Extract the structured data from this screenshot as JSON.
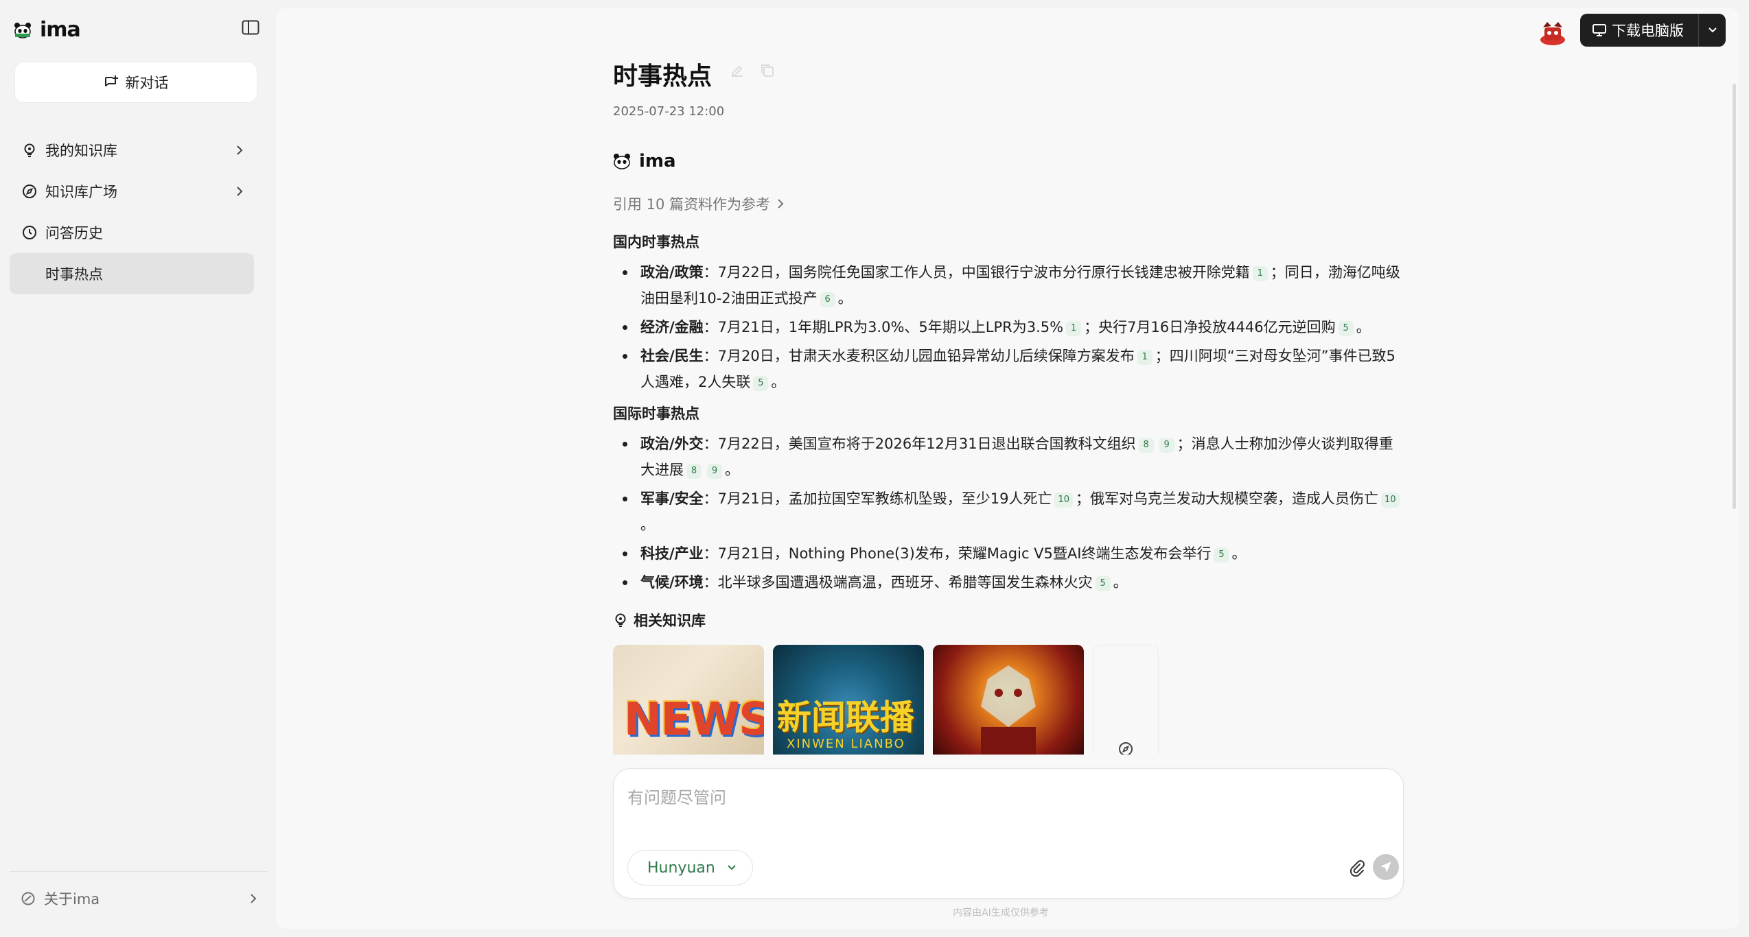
{
  "sidebar": {
    "logo_text": "ima",
    "new_chat_label": "新对话",
    "items": [
      {
        "label": "我的知识库",
        "icon": "bulb-icon"
      },
      {
        "label": "知识库广场",
        "icon": "compass-icon"
      },
      {
        "label": "问答历史",
        "icon": "clock-icon"
      }
    ],
    "history_item": "时事热点",
    "about_label": "关于ima"
  },
  "header": {
    "download_label": "下载电脑版"
  },
  "conversation": {
    "title": "时事热点",
    "timestamp": "2025-07-23 12:00",
    "bot_name": "ima",
    "refs_label": "引用 10 篇资料作为参考",
    "domestic": {
      "heading": "国内时事热点",
      "items": [
        {
          "tag": "政治/政策",
          "p1": "：7月22日，国务院任免国家工作人员，中国银行宁波市分行原行长钱建忠被开除党籍",
          "c1": "1",
          "p2": "；同日，渤海亿吨级油田垦利10-2油田正式投产",
          "c2": "6",
          "p3": "。"
        },
        {
          "tag": "经济/金融",
          "p1": "：7月21日，1年期LPR为3.0%、5年期以上LPR为3.5%",
          "c1": "1",
          "p2": "；央行7月16日净投放4446亿元逆回购",
          "c2": "5",
          "p3": "。"
        },
        {
          "tag": "社会/民生",
          "p1": "：7月20日，甘肃天水麦积区幼儿园血铅异常幼儿后续保障方案发布",
          "c1": "1",
          "p2": "；四川阿坝“三对母女坠河”事件已致5人遇难，2人失联",
          "c2": "5",
          "p3": "。"
        }
      ]
    },
    "international": {
      "heading": "国际时事热点",
      "items": [
        {
          "tag": "政治/外交",
          "p1": "：7月22日，美国宣布将于2026年12月31日退出联合国教科文组织",
          "c1": "8",
          "c1b": "9",
          "p2": "；消息人士称加沙停火谈判取得重大进展",
          "c2": "8",
          "c2b": "9",
          "p3": "。"
        },
        {
          "tag": "军事/安全",
          "p1": "：7月21日，孟加拉国空军教练机坠毁，至少19人死亡",
          "c1": "10",
          "p2": "；俄军对乌克兰发动大规模空袭，造成人员伤亡",
          "c2": "10",
          "p3": "。"
        },
        {
          "tag": "科技/产业",
          "p1": "：7月21日，Nothing Phone(3)发布，荣耀Magic V5暨AI终端生态发布会举行",
          "c1": "5",
          "p3": "。"
        },
        {
          "tag": "气候/环境",
          "p1": "：北半球多国遭遇极端高温，西班牙、希腊等国发生森林火灾",
          "c1": "5",
          "p3": "。"
        }
      ]
    },
    "kb_heading": "相关知识库",
    "kb_cards": [
      {
        "name": "news",
        "art_text": "NEWS"
      },
      {
        "name": "xinwen-lianbo",
        "art_text": "新闻联播",
        "art_sub": "XINWEN LIANBO"
      },
      {
        "name": "dragon"
      }
    ]
  },
  "composer": {
    "placeholder": "有问题尽管问",
    "model": "Hunyuan",
    "disclaimer": "内容由AI生成仅供参考"
  },
  "colors": {
    "accent_green": "#2f7a4a",
    "cite_bg": "#e6f2ea",
    "dark_button": "#1f1f1f"
  }
}
